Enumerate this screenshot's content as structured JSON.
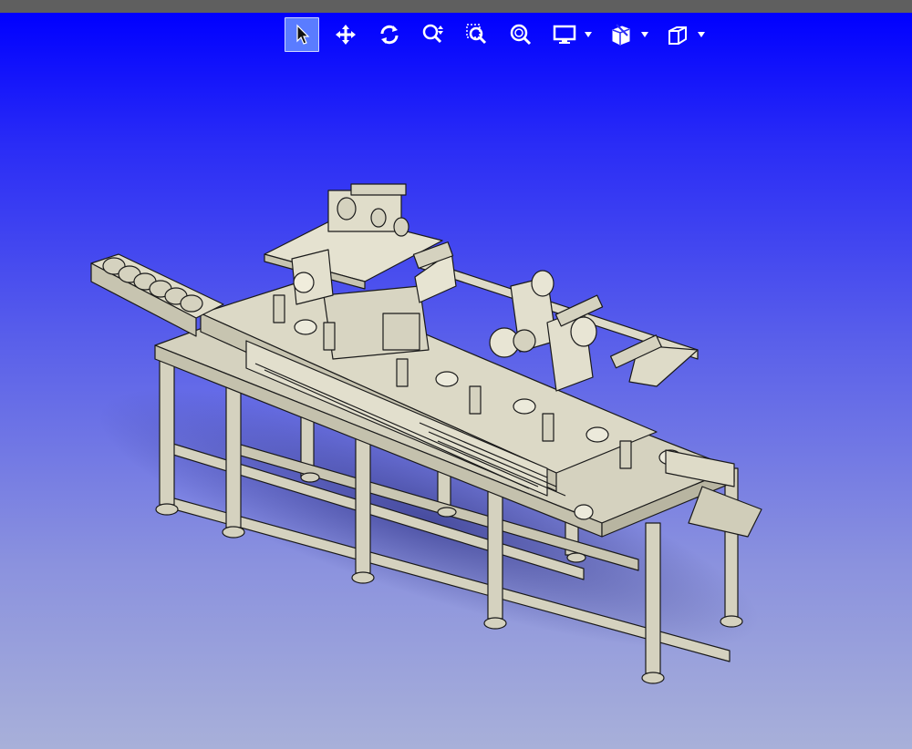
{
  "app": {
    "background_top": "#0000ff",
    "background_bottom": "#a8b0d9",
    "titlebar_color": "#5f5f5f"
  },
  "toolbar": {
    "buttons": [
      {
        "name": "select-tool-button",
        "icon": "arrow-cursor-icon",
        "active": true
      },
      {
        "name": "pan-tool-button",
        "icon": "move-arrows-icon"
      },
      {
        "name": "rotate-tool-button",
        "icon": "rotate-icon"
      },
      {
        "name": "zoom-dynamic-button",
        "icon": "zoom-updown-icon"
      },
      {
        "name": "zoom-window-button",
        "icon": "zoom-window-icon"
      },
      {
        "name": "zoom-fit-button",
        "icon": "zoom-fit-icon"
      },
      {
        "name": "display-mode-button",
        "icon": "monitor-icon",
        "dropdown": true
      },
      {
        "name": "section-view-button",
        "icon": "section-cube-icon",
        "dropdown": true
      },
      {
        "name": "standard-views-button",
        "icon": "cube-icon",
        "dropdown": true
      }
    ]
  },
  "model": {
    "description_icon": "cad-assembly-model",
    "part_color": "#d5d2bf",
    "edge_color": "#1a1a1a"
  }
}
